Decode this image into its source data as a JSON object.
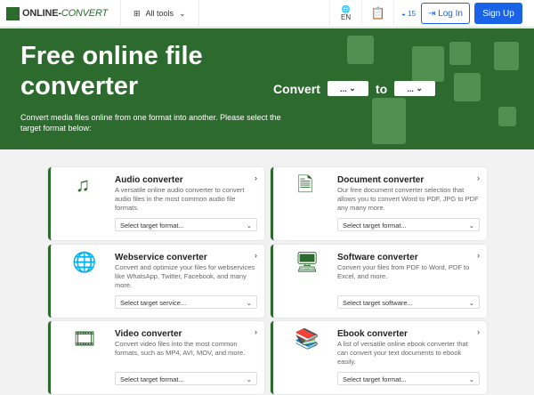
{
  "header": {
    "logo": "ONLINE-CONVERT",
    "logo_suffix": "CONVERT",
    "all_tools": "All tools",
    "lang": "EN",
    "credits": "15",
    "login": "Log In",
    "signup": "Sign Up"
  },
  "hero": {
    "title": "Free online file converter",
    "subtitle": "Convert media files online from one format into another. Please select the target format below:",
    "convert": "Convert",
    "to": "to",
    "from_value": "...",
    "to_value": "..."
  },
  "cards": [
    {
      "title": "Audio converter",
      "desc": "A versatile online audio converter to convert audio files in the most common audio file formats.",
      "select": "Select target format...",
      "icon": "music-note-icon"
    },
    {
      "title": "Document converter",
      "desc": "Our free document converter selection that allows you to convert Word to PDF, JPG to PDF any many more.",
      "select": "Select target format...",
      "icon": "document-icon"
    },
    {
      "title": "Webservice converter",
      "desc": "Convert and optimize your files for webservices like WhatsApp, Twitter, Facebook, and many more.",
      "select": "Select target service...",
      "icon": "globe-icon"
    },
    {
      "title": "Software converter",
      "desc": "Convert your files from PDF to Word, PDF to Excel, and more.",
      "select": "Select target software...",
      "icon": "monitor-icon"
    },
    {
      "title": "Video converter",
      "desc": "Convert video files into the most common formats, such as MP4, AVI, MOV, and more.",
      "select": "Select target format...",
      "icon": "film-icon"
    },
    {
      "title": "Ebook converter",
      "desc": "A list of versatile online ebook converter that can convert your text documents to ebook easily.",
      "select": "Select target format...",
      "icon": "books-icon"
    }
  ],
  "colors": {
    "brand": "#2d6a2e",
    "accent": "#1a62e6"
  }
}
